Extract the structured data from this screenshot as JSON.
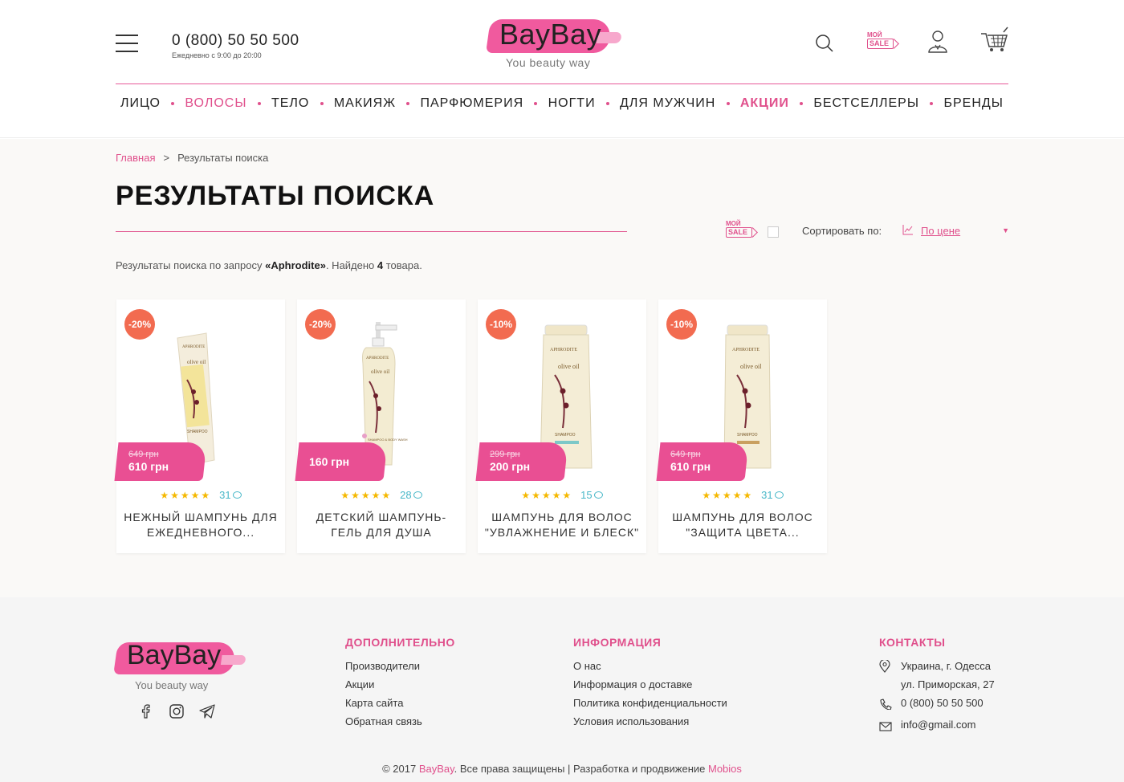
{
  "header": {
    "phone": "0 (800) 50 50 500",
    "phone_hours": "Ежедневно с 9:00 до 20:00",
    "logo_name": "BayBay",
    "logo_tagline": "You beauty way",
    "sale_top": "МОЙ",
    "sale_bottom": "SALE"
  },
  "nav": {
    "items": [
      "ЛИЦО",
      "ВОЛОСЫ",
      "ТЕЛО",
      "МАКИЯЖ",
      "ПАРФЮМЕРИЯ",
      "НОГТИ",
      "ДЛЯ МУЖЧИН",
      "АКЦИИ",
      "БЕСТСЕЛЛЕРЫ",
      "БРЕНДЫ"
    ]
  },
  "breadcrumb": {
    "home": "Главная",
    "separator": ">",
    "current": "Результаты поиска"
  },
  "page": {
    "title": "РЕЗУЛЬТАТЫ ПОИСКА",
    "results_prefix": "Результаты поиска по запросу ",
    "query": "«Aphrodite»",
    "found_text": ". Найдено ",
    "count": "4",
    "items_word": " товара."
  },
  "filters": {
    "sale_top": "МОЙ",
    "sale_bottom": "SALE",
    "sort_label": "Сортировать по:",
    "sort_value": "По цене",
    "sort_arrow": "▼"
  },
  "products": [
    {
      "discount": "-20%",
      "old_price": "649 грн",
      "price": "610 грн",
      "stars": "★★★★★",
      "reviews": "31",
      "name": "НЕЖНЫЙ ШАМПУНЬ ДЛЯ ЕЖЕДНЕВНОГО...",
      "label_top": "APHRODITE",
      "label_mid": "olive oil",
      "label_type": "SHAMPOO"
    },
    {
      "discount": "-20%",
      "old_price": "",
      "price": "160 грн",
      "stars": "★★★★★",
      "reviews": "28",
      "name": "ДЕТСКИЙ ШАМПУНЬ-ГЕЛЬ ДЛЯ ДУША",
      "label_top": "APHRODITE",
      "label_mid": "olive oil",
      "label_type": "SHAMPOO & BODY WASH"
    },
    {
      "discount": "-10%",
      "old_price": "299 грн",
      "price": "200 грн",
      "stars": "★★★★★",
      "reviews": "15",
      "name": "ШАМПУНЬ ДЛЯ ВОЛОС \"УВЛАЖНЕНИЕ И БЛЕСК\"",
      "label_top": "APHRODITE",
      "label_mid": "olive oil",
      "label_type": "SHAMPOO"
    },
    {
      "discount": "-10%",
      "old_price": "649 грн",
      "price": "610 грн",
      "stars": "★★★★★",
      "reviews": "31",
      "name": "ШАМПУНЬ ДЛЯ ВОЛОС \"ЗАЩИТА ЦВЕТА...",
      "label_top": "APHRODITE",
      "label_mid": "olive oil",
      "label_type": "SHAMPOO"
    }
  ],
  "footer": {
    "logo_name": "BayBay",
    "logo_tagline": "You beauty way",
    "col1": {
      "title": "ДОПОЛНИТЕЛЬНО",
      "links": [
        "Производители",
        "Акции",
        "Карта сайта",
        "Обратная связь"
      ]
    },
    "col2": {
      "title": "ИНФОРМАЦИЯ",
      "links": [
        "О нас",
        "Информация о доставке",
        "Политика конфиденциальности",
        "Условия использования"
      ]
    },
    "contacts": {
      "title": "КОНТАКТЫ",
      "address1": "Украина, г. Одесса",
      "address2": "ул. Приморская, 27",
      "phone": "0 (800) 50 50 500",
      "email": "info@gmail.com"
    },
    "copyright_prefix": "© 2017 ",
    "copyright_brand": "BayBay",
    "copyright_mid": ". Все права защищены | Разработка и продвижение ",
    "copyright_dev": "Mobios"
  },
  "colors": {
    "accent": "#e0508c",
    "badge": "#f26b50",
    "price_tag": "#e94f93",
    "star": "#f5b800",
    "review": "#49b8c8"
  },
  "icons": [
    "menu-icon",
    "search-icon",
    "user-icon",
    "cart-icon",
    "chart-icon",
    "facebook-icon",
    "instagram-icon",
    "telegram-icon",
    "location-icon",
    "phone-icon",
    "mail-icon"
  ]
}
